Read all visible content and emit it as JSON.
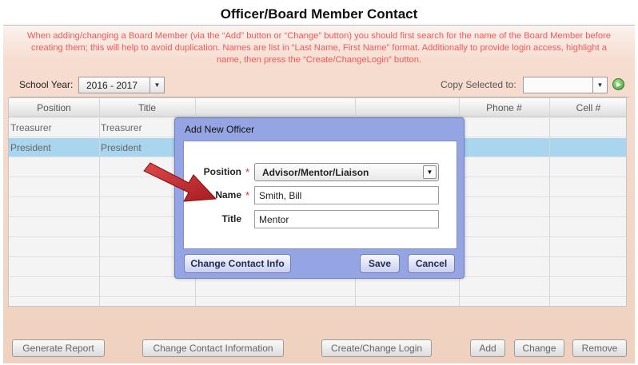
{
  "page": {
    "title": "Officer/Board Member Contact",
    "notice": "When adding/changing a Board Member (via the “Add” button or “Change” button) you should first search for the name of the Board Member before creating them; this will help to avoid duplication. Names are list in “Last Name, First Name” format. Additionally to provide login access, highlight a name, then press the “Create/ChangeLogin” button."
  },
  "toolbar": {
    "school_year_label": "School Year:",
    "school_year_value": "2016 - 2017",
    "copy_label": "Copy Selected to:",
    "copy_value": ""
  },
  "grid": {
    "columns": [
      "Position",
      "Title",
      "",
      "",
      "Phone #",
      "Cell #"
    ],
    "rows": [
      {
        "position": "Treasurer",
        "title": "Treasurer",
        "selected": false
      },
      {
        "position": "President",
        "title": "President",
        "selected": true
      }
    ]
  },
  "buttons": {
    "generate_report": "Generate Report",
    "change_contact_information": "Change Contact Information",
    "create_change_login": "Create/Change Login",
    "add": "Add",
    "change": "Change",
    "remove": "Remove"
  },
  "modal": {
    "title": "Add New Officer",
    "position_label": "Position",
    "position_value": "Advisor/Mentor/Liaison",
    "name_label": "Name",
    "name_value": "Smith, Bill",
    "title_label": "Title",
    "title_value": "Mentor",
    "required_mark": "*",
    "change_contact_button": "Change Contact Info",
    "save_button": "Save",
    "cancel_button": "Cancel"
  },
  "colors": {
    "notice_text": "#f05a5a",
    "selected_row": "#a9d6ee",
    "modal_frame": "#95a4e2",
    "arrow": "#c0282b"
  },
  "icons": [
    "chevron-down-icon",
    "go-arrow-icon",
    "annotation-arrow"
  ]
}
